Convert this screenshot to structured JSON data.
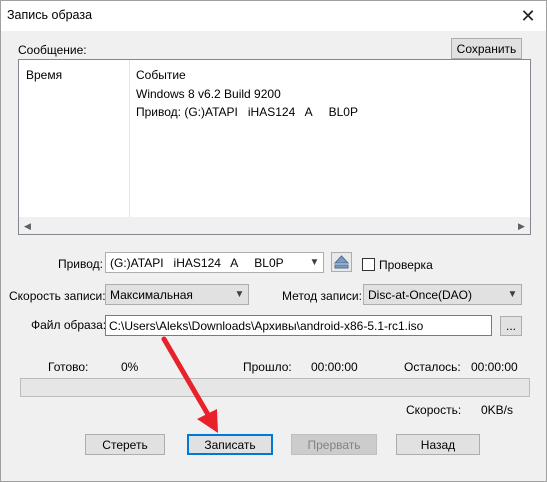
{
  "window": {
    "title": "Запись образа",
    "close_glyph": "✕"
  },
  "message_section": {
    "label": "Сообщение:",
    "save_button": "Сохранить",
    "log": {
      "col_time": "Время",
      "col_event": "Событие",
      "lines": [
        "Windows 8 v6.2 Build 9200",
        "Привод: (G:)ATAPI   iHAS124   A     BL0P"
      ],
      "scroll_left_glyph": "◀",
      "scroll_right_glyph": "▶"
    }
  },
  "drive": {
    "label": "Привод:",
    "value": "(G:)ATAPI   iHAS124   A     BL0P",
    "eject_icon": "eject-icon",
    "verify_label": "Проверка",
    "verify_checked": false
  },
  "speed": {
    "label": "Скорость записи:",
    "value": "Максимальная"
  },
  "method": {
    "label": "Метод записи:",
    "value": "Disc-at-Once(DAO)"
  },
  "image_file": {
    "label": "Файл образа:",
    "value": "C:\\Users\\Aleks\\Downloads\\Архивы\\android-x86-5.1-rc1.iso",
    "browse_label": "..."
  },
  "status": {
    "ready_label": "Готово:",
    "ready_value": "0%",
    "elapsed_label": "Прошло:",
    "elapsed_value": "00:00:00",
    "remaining_label": "Осталось:",
    "remaining_value": "00:00:00",
    "progress_fraction": 0,
    "speed_label": "Скорость:",
    "speed_value": "0KB/s"
  },
  "buttons": {
    "erase": "Стереть",
    "write": "Записать",
    "abort": "Прервать",
    "back": "Назад"
  },
  "colors": {
    "annotation_arrow": "#e8212a",
    "focus_border": "#0078d7"
  }
}
